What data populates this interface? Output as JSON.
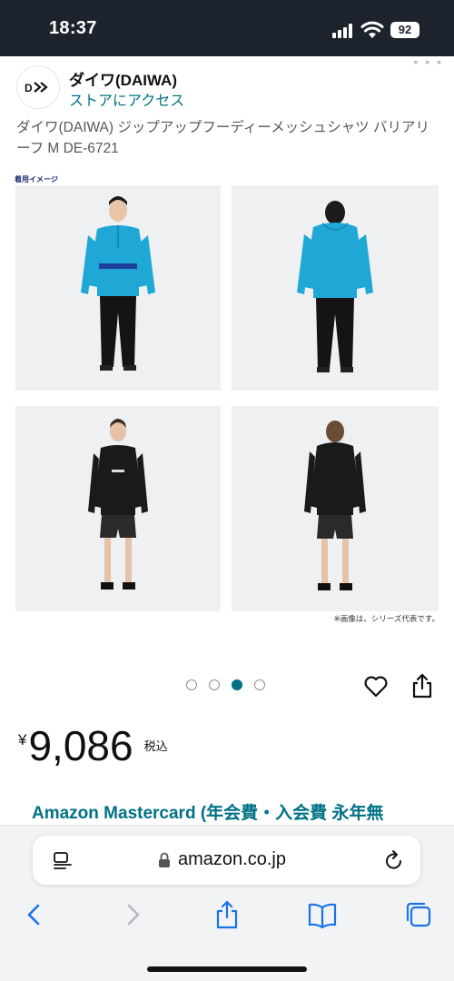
{
  "status_bar": {
    "time": "18:37",
    "battery": "92",
    "icons": [
      "signal-icon",
      "wifi-icon",
      "battery-icon"
    ]
  },
  "store": {
    "name": "ダイワ(DAIWA)",
    "link_label": "ストアにアクセス",
    "logo_icon": "daiwa-logo"
  },
  "product": {
    "title": "ダイワ(DAIWA) ジップアップフーディーメッシュシャツ バリアリーフ M DE-6721",
    "image_caption_top": "着用イメージ",
    "image_caption_bottom": "※画像は、シリーズ代表です。",
    "carousel": {
      "count": 4,
      "active_index": 2
    },
    "price": {
      "symbol": "¥",
      "value": "9,086",
      "tax_label": "税込"
    },
    "promo": "Amazon Mastercard (年会費・入会費 永年無"
  },
  "browser": {
    "url": "amazon.co.jp",
    "toolbar_icons": [
      "back-icon",
      "forward-icon",
      "share-icon",
      "bookmarks-icon",
      "tabs-icon"
    ]
  },
  "colors": {
    "status_bar_bg": "#1c232c",
    "link": "#007185",
    "hoodie_blue": "#1fa8d6",
    "safari_bg": "#f2f3f5"
  }
}
